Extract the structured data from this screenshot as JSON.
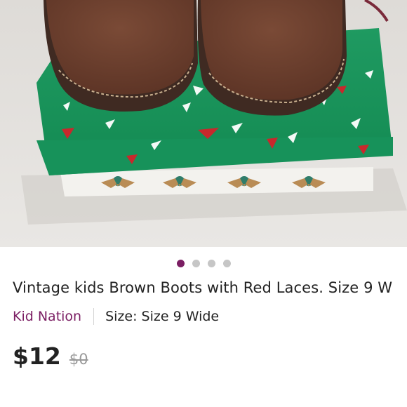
{
  "listing": {
    "title": "Vintage kids Brown Boots with Red Laces. Size 9 W",
    "brand": "Kid Nation",
    "size_label": "Size:",
    "size_value": "Size 9 Wide",
    "price": "$12",
    "original_price": "$0"
  },
  "carousel": {
    "total": 4,
    "active_index": 0
  },
  "colors": {
    "accent": "#7b1e63",
    "inactive_dot": "#c6c6c6"
  }
}
